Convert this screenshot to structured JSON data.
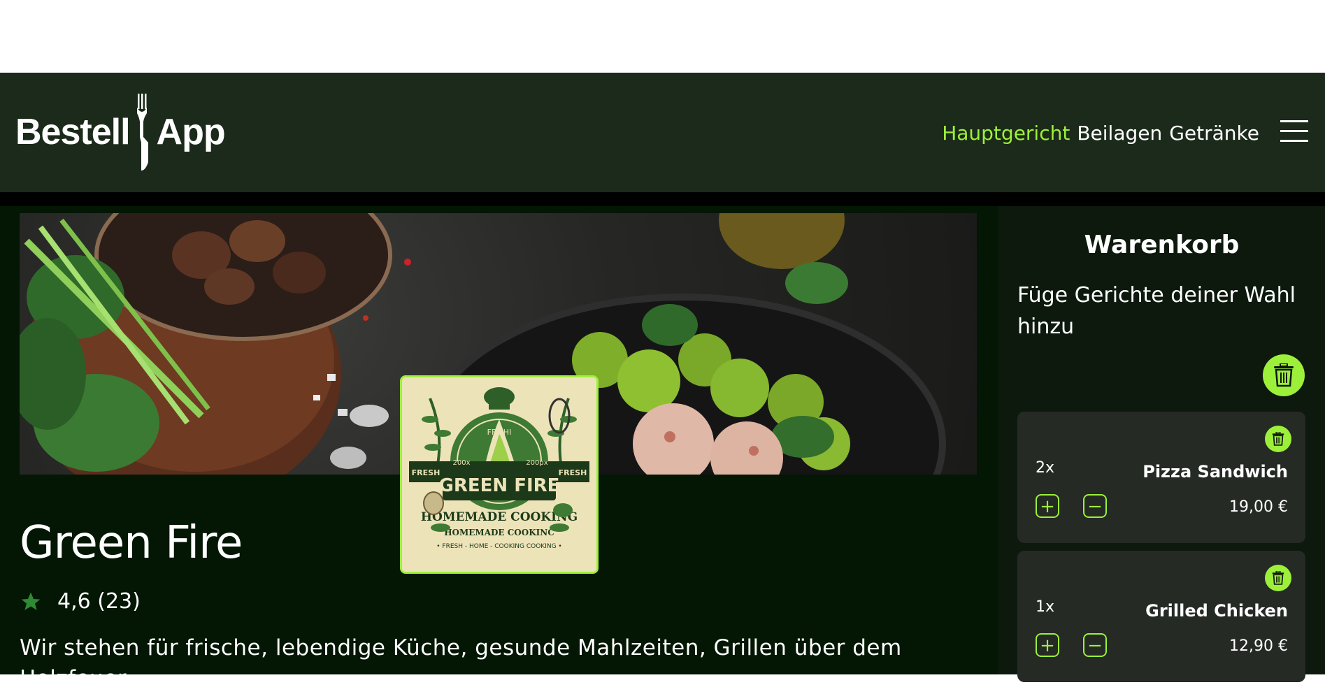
{
  "header": {
    "logo_left": "Bestell",
    "logo_right": "App",
    "nav": [
      "Hauptgericht",
      "Beilagen",
      "Getränke"
    ],
    "active_nav": "Hauptgericht",
    "menu_icon": "hamburger-icon"
  },
  "restaurant": {
    "name": "Green Fire",
    "rating": "4,6 (23)",
    "description": "Wir stehen für frische, lebendige Küche, gesunde Mahlzeiten, Grillen über dem Holzfeuer",
    "logo_text": {
      "title": "GREEN FIRE",
      "left_top": "FRESH",
      "right_top": "FRESH",
      "small_left": "200x",
      "small_right": "200px",
      "arc_top": "FF SHI",
      "arc_bottom": "HOMEMADE COOKING",
      "sub": "HOMEMADE COOKING",
      "sub2": "HOMEMADE COOKINC",
      "footer": "• FRESH - HOME - COOKING COOKING •"
    }
  },
  "cart": {
    "title": "Warenkorb",
    "hint": "Füge Gerichte deiner Wahl hinzu",
    "items": [
      {
        "qty": "2x",
        "name": "Pizza Sandwich",
        "price": "19,00 €",
        "plus": "+",
        "minus": "−"
      },
      {
        "qty": "1x",
        "name": "Grilled Chicken",
        "price": "12,90 €",
        "plus": "+",
        "minus": "−"
      }
    ]
  },
  "colors": {
    "accent": "#9df03a",
    "header_bg": "#1b2a1a",
    "main_bg": "#041604",
    "cart_bg": "#0e190e",
    "item_bg": "#252a25"
  }
}
